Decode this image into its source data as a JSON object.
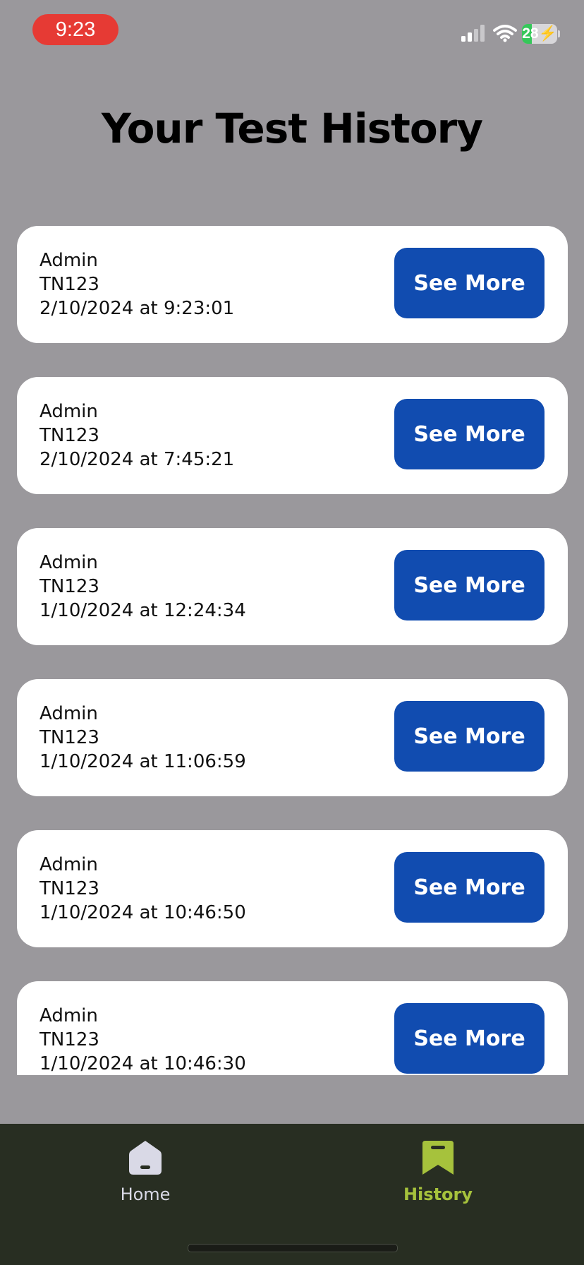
{
  "status_bar": {
    "time": "9:23",
    "battery_level": "28",
    "icons": [
      "cellular-signal-icon",
      "wifi-icon",
      "battery-charging-icon"
    ],
    "colors": {
      "time_pill": "#e63a34",
      "battery_fill": "#35c759"
    }
  },
  "page": {
    "title": "Your Test History"
  },
  "history": [
    {
      "user": "Admin",
      "test_id": "TN123",
      "datetime": "2/10/2024 at 9:23:01",
      "button_label": "See More"
    },
    {
      "user": "Admin",
      "test_id": "TN123",
      "datetime": "2/10/2024 at 7:45:21",
      "button_label": "See More"
    },
    {
      "user": "Admin",
      "test_id": "TN123",
      "datetime": "1/10/2024 at 12:24:34",
      "button_label": "See More"
    },
    {
      "user": "Admin",
      "test_id": "TN123",
      "datetime": "1/10/2024 at 11:06:59",
      "button_label": "See More"
    },
    {
      "user": "Admin",
      "test_id": "TN123",
      "datetime": "1/10/2024 at 10:46:50",
      "button_label": "See More"
    },
    {
      "user": "Admin",
      "test_id": "TN123",
      "datetime": "1/10/2024 at 10:46:30",
      "button_label": "See More"
    }
  ],
  "tab_bar": {
    "tabs": [
      {
        "label": "Home",
        "icon": "home-icon",
        "active": false
      },
      {
        "label": "History",
        "icon": "bookmark-icon",
        "active": true
      }
    ],
    "colors": {
      "background": "#282e22",
      "active": "#a6c23c",
      "inactive": "#d9d9e6"
    }
  },
  "colors": {
    "background": "#9a989c",
    "card": "#ffffff",
    "button": "#114cb0"
  }
}
